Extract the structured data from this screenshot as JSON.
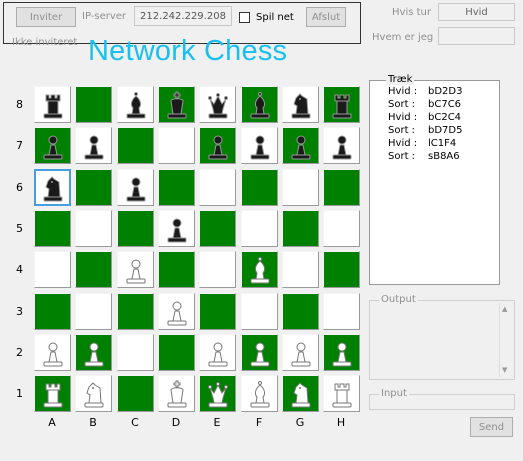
{
  "top": {
    "invite_label": "Inviter",
    "ip_label": "IP-server",
    "ip_value": "212.242.229.208",
    "spilnet_label": "Spil net",
    "quit_label": "Afslut",
    "status": "Ikke inviteret"
  },
  "title": "Network Chess",
  "side": {
    "turn_label": "Hvis tur",
    "turn_value": "Hvid",
    "whoami_label": "Hvem er jeg",
    "whoami_value": "",
    "moves_legend": "Træk",
    "output_legend": "Output",
    "input_legend": "Input",
    "send_label": "Send"
  },
  "moves": [
    {
      "player": "Hvid :",
      "move": "bD2D3"
    },
    {
      "player": "Sort :",
      "move": "bC7C6"
    },
    {
      "player": "Hvid :",
      "move": "bC2C4"
    },
    {
      "player": "Sort :",
      "move": "bD7D5"
    },
    {
      "player": "Hvid :",
      "move": "lC1F4"
    },
    {
      "player": "Sort :",
      "move": "sB8A6"
    }
  ],
  "board": {
    "files": [
      "A",
      "B",
      "C",
      "D",
      "E",
      "F",
      "G",
      "H"
    ],
    "ranks": [
      "8",
      "7",
      "6",
      "5",
      "4",
      "3",
      "2",
      "1"
    ],
    "selected": "A6",
    "pieces": {
      "A8": {
        "type": "rook",
        "color": "black"
      },
      "C8": {
        "type": "bishop",
        "color": "black"
      },
      "D8": {
        "type": "king",
        "color": "black"
      },
      "E8": {
        "type": "queen",
        "color": "black"
      },
      "F8": {
        "type": "bishop",
        "color": "black"
      },
      "G8": {
        "type": "knight",
        "color": "black"
      },
      "H8": {
        "type": "rook",
        "color": "black"
      },
      "A7": {
        "type": "pawn",
        "color": "black"
      },
      "B7": {
        "type": "pawn",
        "color": "black"
      },
      "E7": {
        "type": "pawn",
        "color": "black"
      },
      "F7": {
        "type": "pawn",
        "color": "black"
      },
      "G7": {
        "type": "pawn",
        "color": "black"
      },
      "H7": {
        "type": "pawn",
        "color": "black"
      },
      "A6": {
        "type": "knight",
        "color": "black"
      },
      "C6": {
        "type": "pawn",
        "color": "black"
      },
      "D5": {
        "type": "pawn",
        "color": "black"
      },
      "C4": {
        "type": "pawn",
        "color": "white"
      },
      "F4": {
        "type": "bishop",
        "color": "white"
      },
      "D3": {
        "type": "pawn",
        "color": "white"
      },
      "A2": {
        "type": "pawn",
        "color": "white"
      },
      "B2": {
        "type": "pawn",
        "color": "white"
      },
      "E2": {
        "type": "pawn",
        "color": "white"
      },
      "F2": {
        "type": "pawn",
        "color": "white"
      },
      "G2": {
        "type": "pawn",
        "color": "white"
      },
      "H2": {
        "type": "pawn",
        "color": "white"
      },
      "A1": {
        "type": "rook",
        "color": "white"
      },
      "B1": {
        "type": "knight",
        "color": "white"
      },
      "D1": {
        "type": "king",
        "color": "white"
      },
      "E1": {
        "type": "queen",
        "color": "white"
      },
      "F1": {
        "type": "bishop",
        "color": "white"
      },
      "G1": {
        "type": "knight",
        "color": "white"
      },
      "H1": {
        "type": "rook",
        "color": "white"
      }
    }
  },
  "colors": {
    "dark_square": "#008000",
    "light_square": "#ffffff",
    "title": "#19c0ee"
  }
}
